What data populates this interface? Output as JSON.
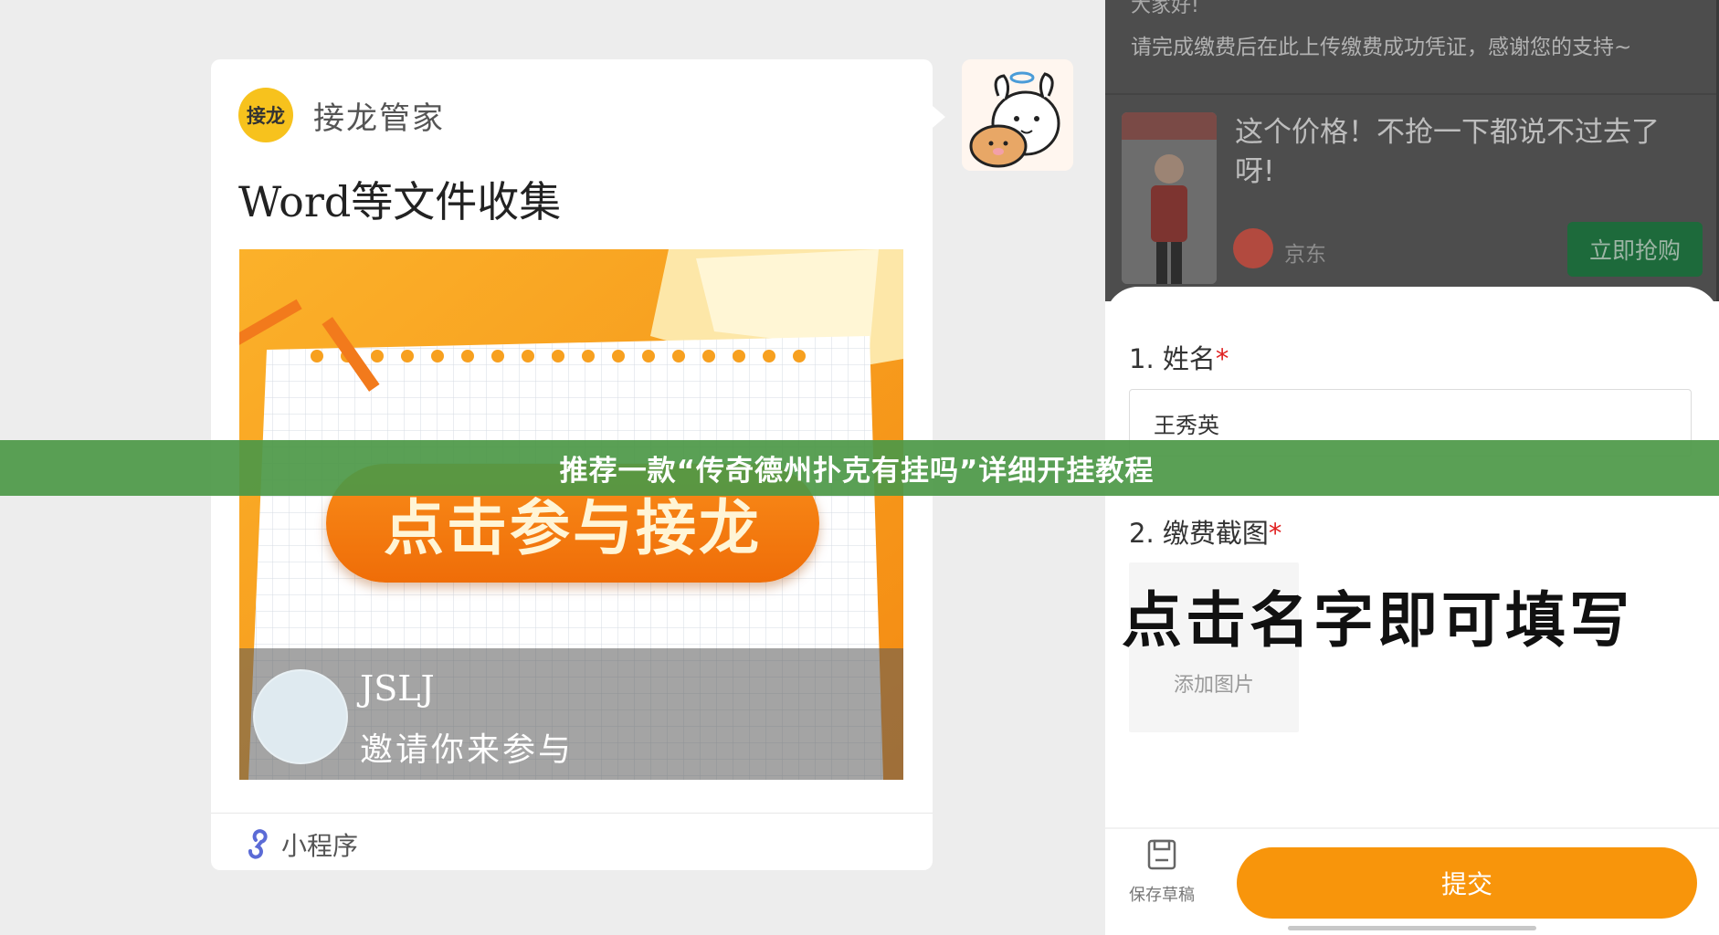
{
  "chat": {
    "app_logo_text": "接龙",
    "app_name": "接龙管家",
    "card_title": "Word等文件收集",
    "banner_cta": "点击参与接龙",
    "user_name": "JSLJ",
    "invite_text": "邀请你来参与",
    "miniprogram_label": "小程序",
    "icons": [
      "mini-program-icon",
      "sticker-image"
    ]
  },
  "form": {
    "notice_hello": "大家好!",
    "notice_text": "请完成缴费后在此上传缴费成功凭证，感谢您的支持~",
    "ad": {
      "title": "这个价格！不抢一下都说不过去了呀!",
      "brand": "京东",
      "button": "立即抢购"
    },
    "q1_label": "1. 姓名",
    "q1_required": "*",
    "q1_value": "王秀英",
    "q2_label": "2. 缴费截图",
    "q2_required": "*",
    "upload_label": "添加图片",
    "overlay_hint": "点击名字即可填写",
    "save_draft": "保存草稿",
    "submit": "提交",
    "colors": {
      "submit": "#f8950b",
      "required": "#e02020",
      "ad_button": "#1d6a3b"
    }
  },
  "headline": "推荐一款“传奇德州扑克有挂吗”详细开挂教程"
}
